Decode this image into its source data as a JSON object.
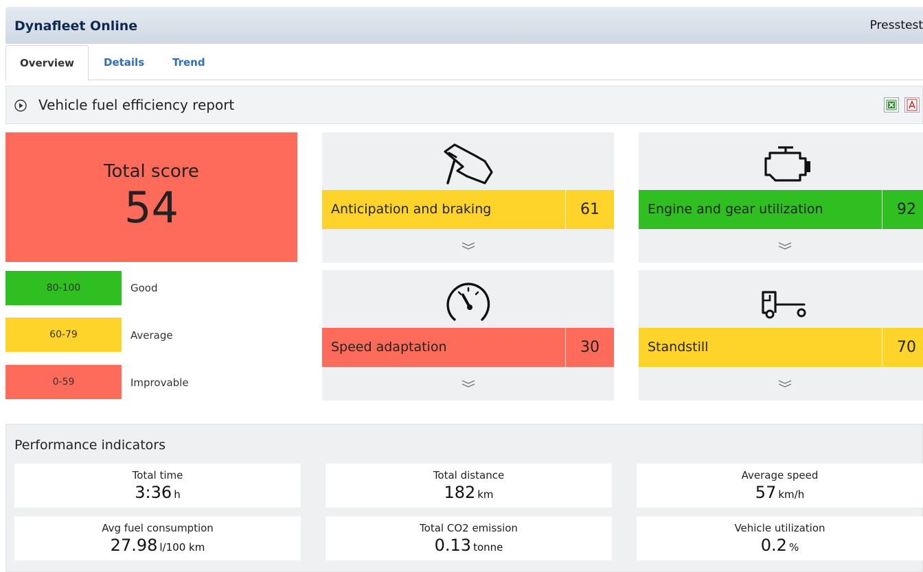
{
  "header": {
    "app_title": "Dynafleet Online",
    "user": "Presstest"
  },
  "tabs": [
    {
      "label": "Overview",
      "active": true
    },
    {
      "label": "Details",
      "active": false
    },
    {
      "label": "Trend",
      "active": false
    }
  ],
  "report": {
    "title": "Vehicle fuel efficiency report"
  },
  "total_score": {
    "label": "Total score",
    "value": "54",
    "color": "#ff6b5b"
  },
  "legend": [
    {
      "range": "80-100",
      "label": "Good",
      "color": "#2fbf21"
    },
    {
      "range": "60-79",
      "label": "Average",
      "color": "#ffd42a"
    },
    {
      "range": "0-59",
      "label": "Improvable",
      "color": "#ff6b5b"
    }
  ],
  "categories": [
    {
      "name": "Anticipation and braking",
      "score": "61",
      "color": "#ffd42a",
      "icon": "hand-braking-icon"
    },
    {
      "name": "Engine and gear utilization",
      "score": "92",
      "color": "#2fbf21",
      "icon": "engine-icon"
    },
    {
      "name": "Speed adaptation",
      "score": "30",
      "color": "#ff6b5b",
      "icon": "speedometer-icon"
    },
    {
      "name": "Standstill",
      "score": "70",
      "color": "#ffd42a",
      "icon": "truck-trailer-icon"
    }
  ],
  "performance": {
    "title": "Performance indicators",
    "items": [
      {
        "label": "Total time",
        "value": "3:36",
        "unit": "h"
      },
      {
        "label": "Total distance",
        "value": "182",
        "unit": "km"
      },
      {
        "label": "Average speed",
        "value": "57",
        "unit": "km/h"
      },
      {
        "label": "Avg fuel consumption",
        "value": "27.98",
        "unit": "l/100 km"
      },
      {
        "label": "Total CO2 emission",
        "value": "0.13",
        "unit": "tonne"
      },
      {
        "label": "Vehicle utilization",
        "value": "0.2",
        "unit": "%"
      }
    ]
  }
}
